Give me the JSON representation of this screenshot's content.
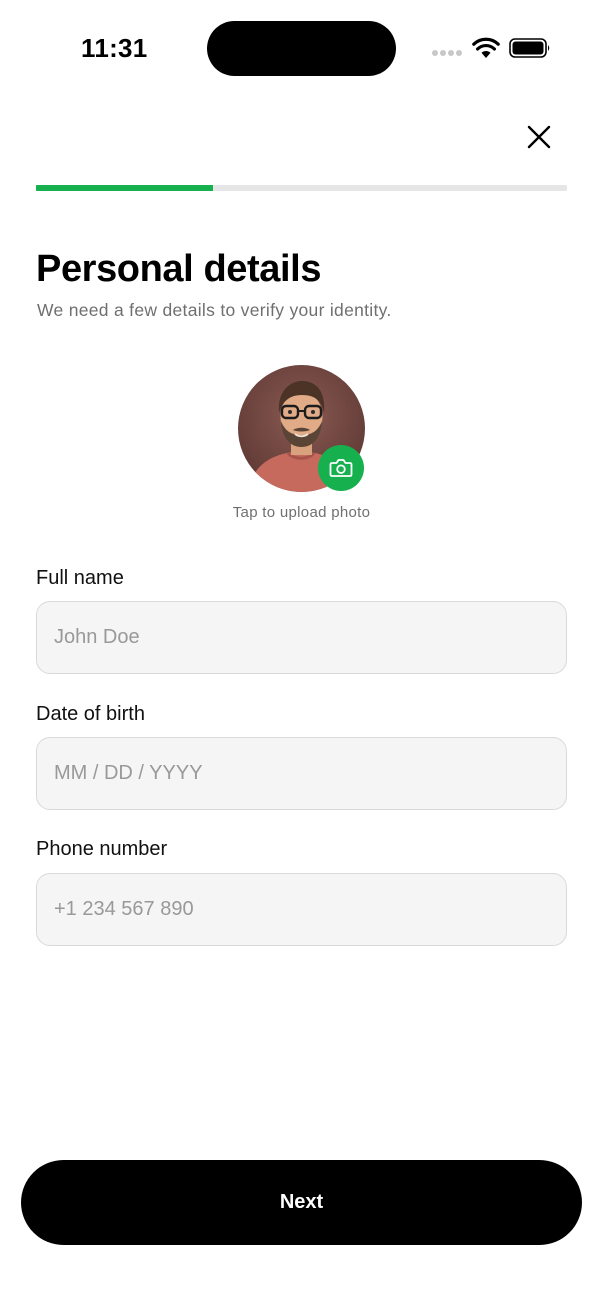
{
  "status_bar": {
    "time": "11:31"
  },
  "header": {
    "close_icon": "close-icon",
    "progress_fraction": 0.333
  },
  "title": "Personal details",
  "subtitle": "We need a few details to verify your identity.",
  "photo": {
    "caption": "Tap to upload photo",
    "badge_icon": "camera-icon"
  },
  "fields": [
    {
      "label": "Full name",
      "placeholder": "John Doe",
      "value": ""
    },
    {
      "label": "Date of birth",
      "placeholder": "MM / DD / YYYY",
      "value": ""
    },
    {
      "label": "Phone number",
      "placeholder": "+1 234 567 890",
      "value": ""
    }
  ],
  "next_button": {
    "label": "Next"
  },
  "colors": {
    "accent": "#16b14e",
    "progress_track": "#e6e6e6",
    "input_background": "#f5f5f5",
    "primary_button": "#000000",
    "muted_text": "#6f6f6f"
  }
}
